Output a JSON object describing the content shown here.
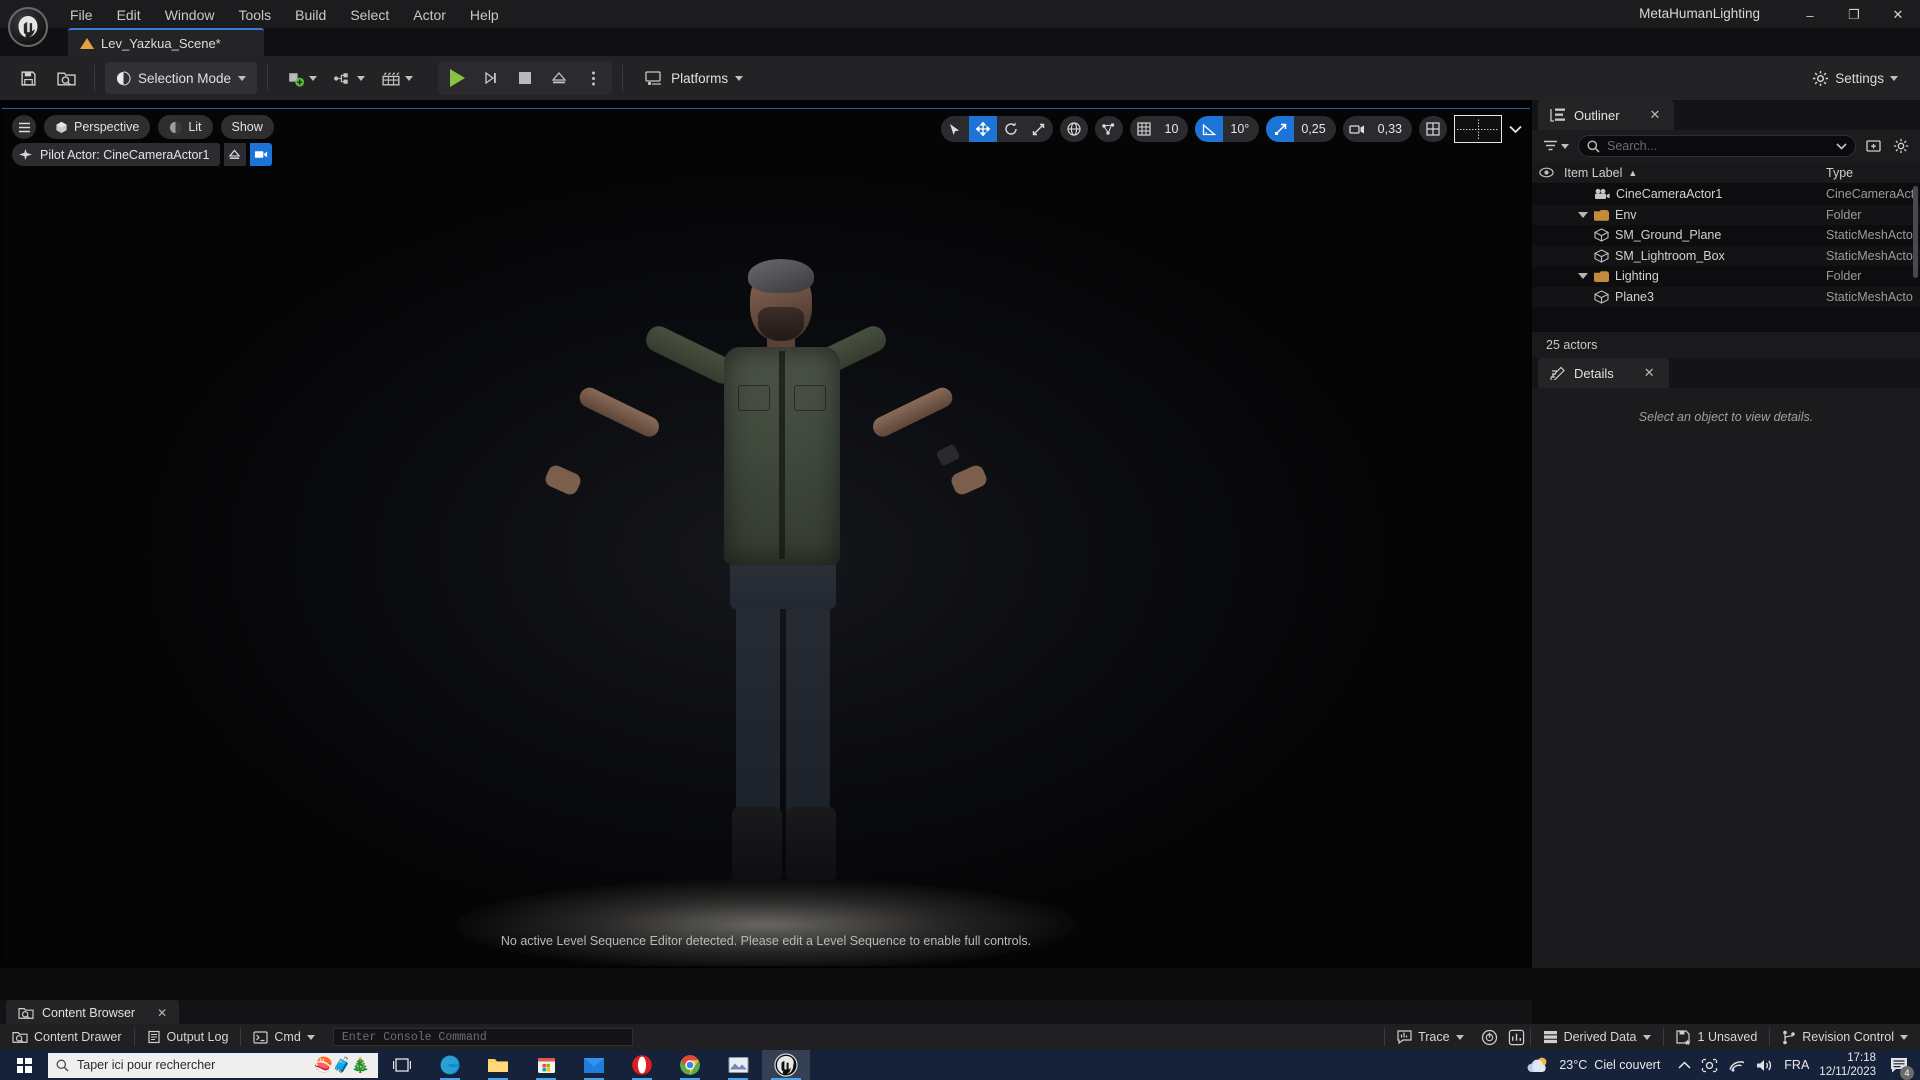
{
  "titlebar": {
    "menus": [
      "File",
      "Edit",
      "Window",
      "Tools",
      "Build",
      "Select",
      "Actor",
      "Help"
    ],
    "window_title": "MetaHumanLighting",
    "minimize": "–",
    "maximize": "❐",
    "close": "✕"
  },
  "level_tab": {
    "label": "Lev_Yazkua_Scene*",
    "icon": "level-triangle-icon"
  },
  "toolbar": {
    "save_icon": "save-icon",
    "browse_icon": "browse-content-icon",
    "selection_mode": "Selection Mode",
    "add_icon": "add-actor-icon",
    "blueprint_icon": "blueprints-icon",
    "sequencer_icon": "cinematics-icon",
    "play": "play-icon",
    "step": "step-icon",
    "stop": "stop-icon",
    "eject": "eject-icon",
    "more": "more-options-icon",
    "platforms": "Platforms",
    "settings": "Settings"
  },
  "viewport": {
    "menu_icon": "viewport-menu-icon",
    "perspective": "Perspective",
    "lit": "Lit",
    "show": "Show",
    "pilot_actor": "Pilot Actor: CineCameraActor1",
    "pilot_eject_icon": "eject-pilot-icon",
    "pilot_camera_icon": "camera-icon",
    "transform_tools": [
      {
        "name": "select-tool",
        "icon": "cursor-icon",
        "active": false
      },
      {
        "name": "move-tool",
        "icon": "move-icon",
        "active": true
      },
      {
        "name": "rotate-tool",
        "icon": "rotate-icon",
        "active": false
      },
      {
        "name": "scale-tool",
        "icon": "scale-icon",
        "active": false
      }
    ],
    "coord_system_icon": "world-globe-icon",
    "surface_snap_icon": "surface-snap-icon",
    "grid_snap": {
      "icon": "grid-icon",
      "value": "10",
      "active": false
    },
    "angle_snap": {
      "icon": "angle-icon",
      "value": "10°",
      "active": true
    },
    "scale_snap": {
      "icon": "scale-snap-icon",
      "value": "0,25",
      "active": true
    },
    "camera_speed": {
      "icon": "camera-speed-icon",
      "value": "0,33"
    },
    "layout_grid_icon": "viewport-layout-icon",
    "maximize_icon": "layout-chooser-icon",
    "notice": "No active Level Sequence Editor detected. Please edit a Level Sequence to enable full controls."
  },
  "outliner": {
    "tab_label": "Outliner",
    "close": "✕",
    "filter_icon": "filter-icon",
    "search_placeholder": "Search...",
    "search_value": "",
    "add_folder_icon": "new-folder-icon",
    "settings_icon": "gear-icon",
    "visibility_icon": "eye-icon",
    "columns": [
      "Item Label",
      "Type"
    ],
    "sort_indicator": "▲",
    "rows": [
      {
        "label": "CineCameraActor1",
        "type": "CineCameraAct",
        "icon": "camera-actor-icon",
        "indent": 3,
        "expandable": false
      },
      {
        "label": "Env",
        "type": "Folder",
        "icon": "folder-icon",
        "indent": 2,
        "expandable": true
      },
      {
        "label": "SM_Ground_Plane",
        "type": "StaticMeshActo",
        "icon": "static-mesh-icon",
        "indent": 3,
        "expandable": false
      },
      {
        "label": "SM_Lightroom_Box",
        "type": "StaticMeshActo",
        "icon": "static-mesh-icon",
        "indent": 3,
        "expandable": false
      },
      {
        "label": "Lighting",
        "type": "Folder",
        "icon": "folder-icon",
        "indent": 2,
        "expandable": true
      },
      {
        "label": "Plane3",
        "type": "StaticMeshActo",
        "icon": "static-mesh-icon",
        "indent": 3,
        "expandable": false
      }
    ],
    "actor_count": "25 actors"
  },
  "details": {
    "tab_label": "Details",
    "close": "✕",
    "empty_message": "Select an object to view details."
  },
  "content_browser": {
    "tab_label": "Content Browser",
    "close": "✕"
  },
  "statusbar": {
    "content_drawer": "Content Drawer",
    "output_log": "Output Log",
    "cmd_label": "Cmd",
    "console_placeholder": "Enter Console Command",
    "trace": "Trace",
    "derived_data": "Derived Data",
    "unsaved": "1 Unsaved",
    "revision_control": "Revision Control"
  },
  "taskbar": {
    "search_placeholder": "Taper ici pour rechercher",
    "apps": [
      "task-view-icon",
      "edge-icon",
      "file-explorer-icon",
      "microsoft-store-icon",
      "mail-icon",
      "opera-icon",
      "chrome-icon",
      "photo-viewer-icon",
      "unreal-engine-icon"
    ],
    "weather_temp": "23°C",
    "weather_desc": "Ciel couvert",
    "language": "FRA",
    "time": "17:18",
    "date": "12/11/2023",
    "notification_count": "4"
  },
  "colors": {
    "accent_blue": "#1b74d6",
    "play_green": "#89c240",
    "tab_orange": "#e0a243",
    "taskbar": "#16213a"
  }
}
